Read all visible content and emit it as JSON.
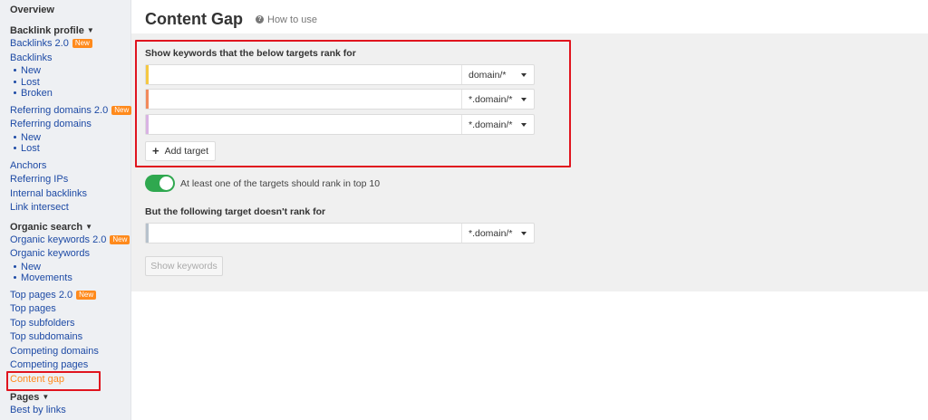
{
  "sidebar": {
    "overview": "Overview",
    "backlink_profile": {
      "heading": "Backlink profile",
      "items": [
        {
          "label": "Backlinks 2.0",
          "badge": "New"
        },
        {
          "label": "Backlinks"
        }
      ],
      "backlinks_sub": [
        "New",
        "Lost",
        "Broken"
      ],
      "items2": [
        {
          "label": "Referring domains 2.0",
          "badge": "New"
        },
        {
          "label": "Referring domains"
        }
      ],
      "refdomains_sub": [
        "New",
        "Lost"
      ],
      "items3": [
        "Anchors",
        "Referring IPs",
        "Internal backlinks",
        "Link intersect"
      ]
    },
    "organic_search": {
      "heading": "Organic search",
      "items": [
        {
          "label": "Organic keywords 2.0",
          "badge": "New"
        },
        {
          "label": "Organic keywords"
        }
      ],
      "keywords_sub": [
        "New",
        "Movements"
      ],
      "items2": [
        {
          "label": "Top pages 2.0",
          "badge": "New"
        },
        {
          "label": "Top pages"
        },
        {
          "label": "Top subfolders"
        },
        {
          "label": "Top subdomains"
        },
        {
          "label": "Competing domains"
        },
        {
          "label": "Competing pages"
        },
        {
          "label": "Content gap"
        }
      ]
    },
    "pages": {
      "heading": "Pages",
      "items": [
        "Best by links"
      ]
    }
  },
  "header": {
    "title": "Content Gap",
    "help_icon": "?",
    "help_text": "How to use"
  },
  "form": {
    "targets_label": "Show keywords that the below targets rank for",
    "targets": [
      {
        "value": "",
        "mode": "domain/*",
        "color": "#f5c842"
      },
      {
        "value": "",
        "mode": "*.domain/*",
        "color": "#f28a5c"
      },
      {
        "value": "",
        "mode": "*.domain/*",
        "color": "#d9b3e3"
      }
    ],
    "add_target_label": "Add target",
    "toggle_label": "At least one of the targets should rank in top 10",
    "toggle_on": true,
    "exclude_label": "But the following target doesn't rank for",
    "exclude_target": {
      "value": "",
      "mode": "*.domain/*",
      "color": "#b7c2cc"
    },
    "submit_label": "Show keywords"
  },
  "colors": {
    "link": "#1d4aa5",
    "accent": "#ff8a1c",
    "highlight": "#e0141e",
    "toggle": "#2fa84f"
  }
}
